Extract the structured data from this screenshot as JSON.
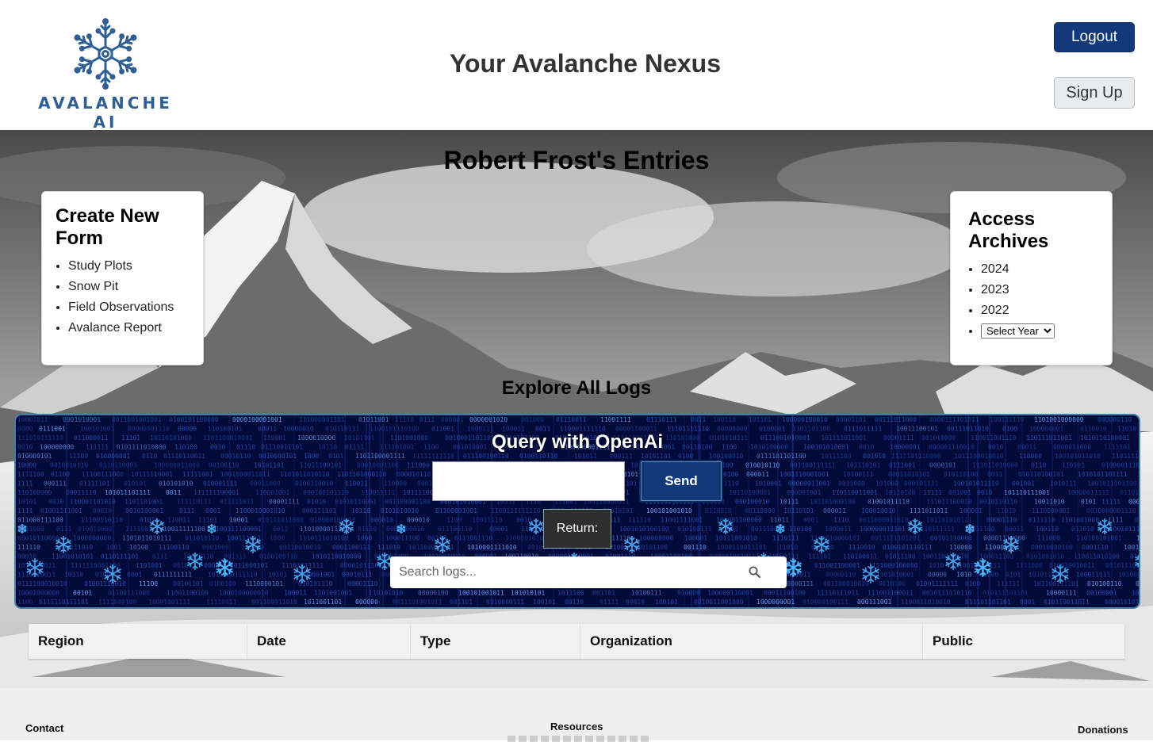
{
  "header": {
    "logo_text": "AVALANCHE AI",
    "title": "Your Avalanche Nexus",
    "logout_label": "Logout",
    "signup_label": "Sign Up"
  },
  "hero": {
    "title": "Robert Frost's Entries",
    "explore_title": "Explore All Logs"
  },
  "create_form": {
    "title": "Create New Form",
    "items": [
      "Study Plots",
      "Snow Pit",
      "Field Observations",
      "Avalance Report"
    ]
  },
  "archives": {
    "title": "Access Archives",
    "years": [
      "2024",
      "2023",
      "2022"
    ],
    "select_value": "Select Year"
  },
  "query": {
    "title": "Query with OpenAi",
    "input_value": "",
    "send_label": "Send",
    "return_label": "Return:",
    "search_placeholder": "Search logs..."
  },
  "table": {
    "columns": [
      "Region",
      "Date",
      "Type",
      "Organization",
      "Public"
    ]
  },
  "footer": {
    "contact": "Contact",
    "resources": "Resources",
    "donations": "Donations"
  },
  "colors": {
    "brand_blue": "#123a7a",
    "logo_blue": "#2f5f94",
    "panel_bg": "#020a3a"
  }
}
